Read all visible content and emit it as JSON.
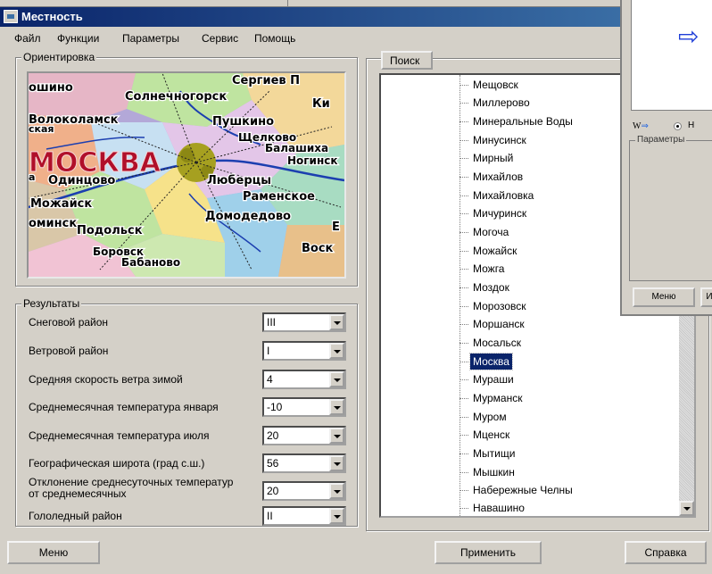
{
  "window": {
    "title": "Местность"
  },
  "menu": [
    "Файл",
    "Функции",
    "Параметры",
    "Сервис",
    "Помощь"
  ],
  "orientation": {
    "legend": "Ориентировка",
    "map_labels": {
      "moscow": "МОСКВА",
      "solnechnogorsk": "Солнечногорск",
      "sergiev": "Сергиев П",
      "ki": "Ки",
      "volokolamsk": "Волоколамск",
      "pushkino": "Пушкино",
      "shchelkovo": "Щелково",
      "balashikha": "Балашиха",
      "odintsovo": "Одинцово",
      "lyubertsy": "Люберцы",
      "mozhaysk": "Можайск",
      "ramenskoe": "Раменское",
      "domodedovo": "Домодедово",
      "podolsk": "Подольск",
      "vosk": "Воск",
      "fragment_shino": "ошино",
      "fragment_minsk": "оминск",
      "fragment_borovsk": "Боровск",
      "fragment_bykovo": "Бабаново",
      "fragment_skaya": "ская",
      "fragment_noginsk": "Ногинск",
      "fragment_e": "Е",
      "fragment_a": "а"
    }
  },
  "results": {
    "legend": "Результаты",
    "rows": [
      {
        "label": "Снеговой район",
        "value": "III"
      },
      {
        "label": "Ветровой район",
        "value": "I"
      },
      {
        "label": "Средняя скорость ветра зимой",
        "value": "4"
      },
      {
        "label": "Среднемесячная температура января",
        "value": "-10"
      },
      {
        "label": "Среднемесячная температура июля",
        "value": "20"
      },
      {
        "label": "Географическая широта (град с.ш.)",
        "value": "56"
      },
      {
        "label": "Отклонение среднесуточных температур от среднемесячных",
        "value": "20"
      },
      {
        "label": "Гололедный район",
        "value": "II"
      }
    ]
  },
  "search": {
    "tab_label": "Поиск",
    "items": [
      "Мещовск",
      "Миллерово",
      "Минеральные Воды",
      "Минусинск",
      "Мирный",
      "Михайлов",
      "Михайловка",
      "Мичуринск",
      "Могоча",
      "Можайск",
      "Можга",
      "Моздок",
      "Морозовск",
      "Моршанск",
      "Мосальск",
      "Москва",
      "Мураши",
      "Мурманск",
      "Муром",
      "Мценск",
      "Мытищи",
      "Мышкин",
      "Набережные Челны",
      "Навашино"
    ],
    "selected": "Москва"
  },
  "buttons": {
    "menu": "Меню",
    "apply": "Применить",
    "help": "Справка"
  },
  "overlay": {
    "w_label": "W",
    "w_arrow": "⇒",
    "radio_text": "Н",
    "params_legend": "Параметры",
    "menu_button": "Меню",
    "cut_button": "И",
    "arrow_icon": "⇨"
  }
}
